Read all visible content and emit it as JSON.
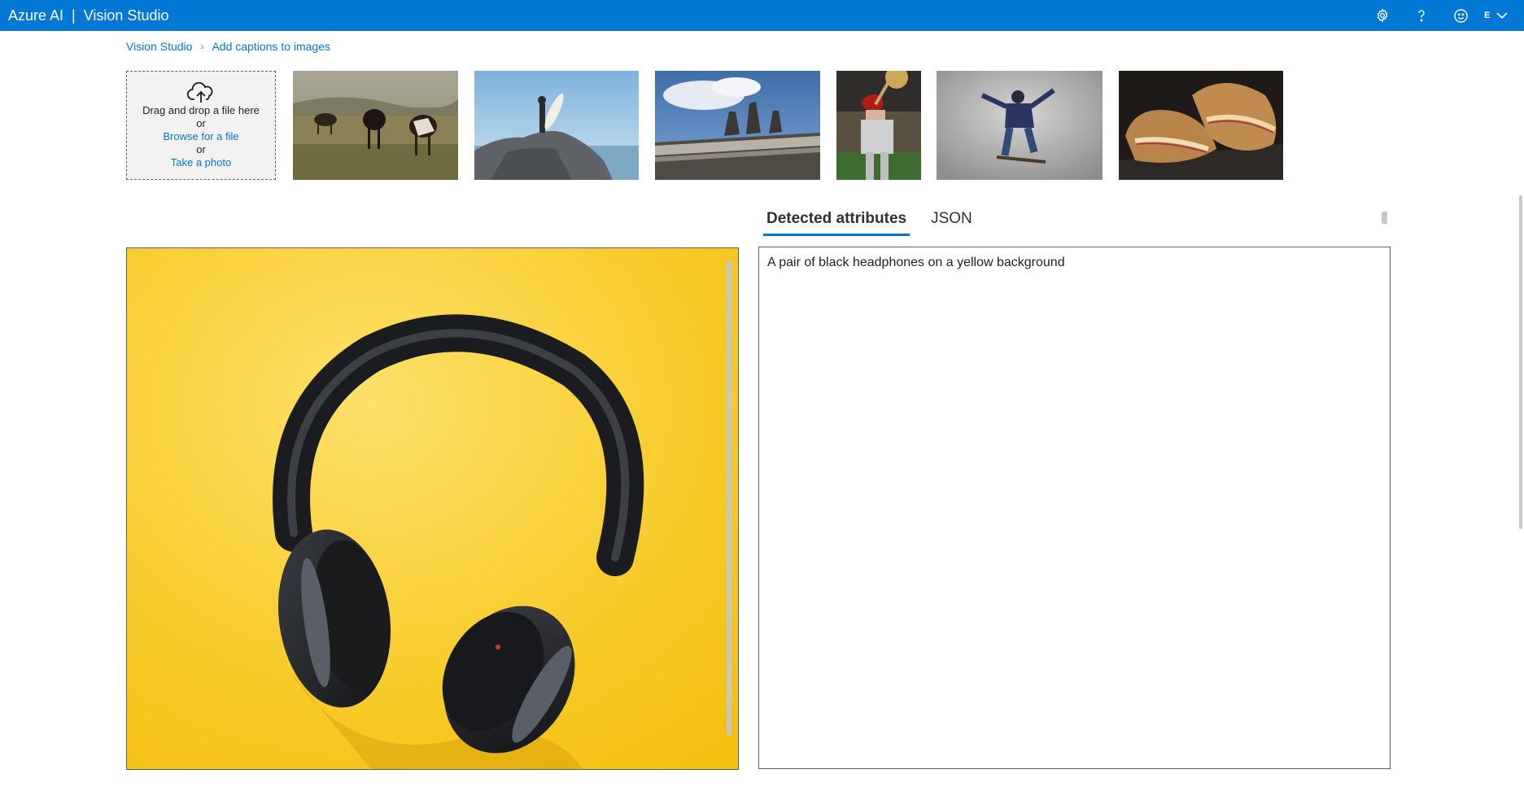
{
  "header": {
    "brand_left": "Azure AI",
    "brand_sep": "|",
    "brand_right": "Vision Studio",
    "avatar_initial": "E",
    "icons": [
      "gear-icon",
      "help-icon",
      "smiley-icon",
      "chevron-down-icon"
    ],
    "color": "#0078d4"
  },
  "breadcrumb": {
    "items": [
      "Vision Studio",
      "Add captions to images"
    ],
    "separator": "›"
  },
  "upload": {
    "drag_text": "Drag and drop a file here",
    "or1": "or",
    "browse_label": "Browse for a file",
    "or2": "or",
    "photo_label": "Take a photo",
    "icon": "cloud-upload-icon"
  },
  "samples": [
    {
      "name": "cows-grazing-thumbnail"
    },
    {
      "name": "surfer-on-rock-thumbnail"
    },
    {
      "name": "building-statues-thumbnail"
    },
    {
      "name": "baseball-batter-thumbnail"
    },
    {
      "name": "skateboarder-thumbnail"
    },
    {
      "name": "grilled-sandwich-thumbnail"
    }
  ],
  "tabs": {
    "detected_label": "Detected attributes",
    "json_label": "JSON",
    "active": "Detected attributes"
  },
  "result": {
    "caption": "A pair of black headphones on a yellow background"
  }
}
